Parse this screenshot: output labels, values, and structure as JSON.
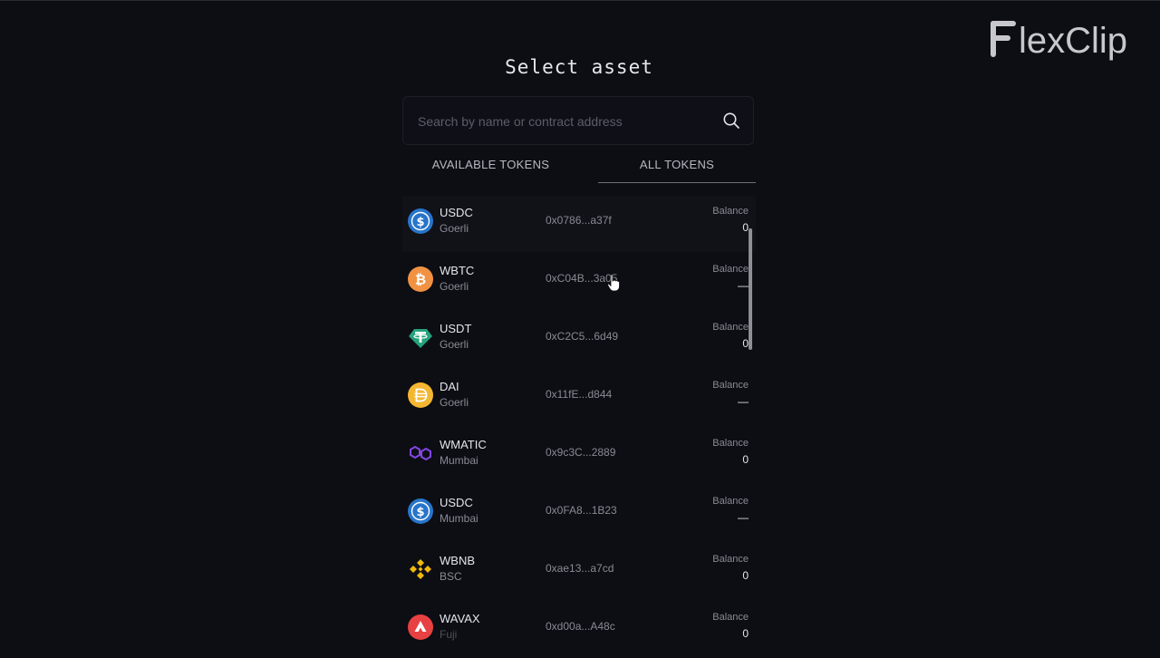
{
  "watermark": "FlexClip",
  "title": "Select asset",
  "search": {
    "placeholder": "Search by name or contract address"
  },
  "tabs": [
    {
      "label": "AVAILABLE TOKENS",
      "active": false
    },
    {
      "label": "ALL TOKENS",
      "active": true
    }
  ],
  "tokens": [
    {
      "symbol": "USDC",
      "network": "Goerli",
      "address": "0x0786...a37f",
      "balance_label": "Balance",
      "balance": "0",
      "icon": "usdc-icon"
    },
    {
      "symbol": "WBTC",
      "network": "Goerli",
      "address": "0xC04B...3a05",
      "balance_label": "Balance",
      "balance": "—",
      "icon": "wbtc-icon"
    },
    {
      "symbol": "USDT",
      "network": "Goerli",
      "address": "0xC2C5...6d49",
      "balance_label": "Balance",
      "balance": "0",
      "icon": "usdt-icon"
    },
    {
      "symbol": "DAI",
      "network": "Goerli",
      "address": "0x11fE...d844",
      "balance_label": "Balance",
      "balance": "—",
      "icon": "dai-icon"
    },
    {
      "symbol": "WMATIC",
      "network": "Mumbai",
      "address": "0x9c3C...2889",
      "balance_label": "Balance",
      "balance": "0",
      "icon": "polygon-icon"
    },
    {
      "symbol": "USDC",
      "network": "Mumbai",
      "address": "0x0FA8...1B23",
      "balance_label": "Balance",
      "balance": "—",
      "icon": "usdc-icon"
    },
    {
      "symbol": "WBNB",
      "network": "BSC",
      "address": "0xae13...a7cd",
      "balance_label": "Balance",
      "balance": "0",
      "icon": "bnb-icon"
    },
    {
      "symbol": "WAVAX",
      "network": "Fuji",
      "address": "0xd00a...A48c",
      "balance_label": "Balance",
      "balance": "0",
      "icon": "avax-icon"
    }
  ],
  "colors": {
    "background": "#0d0d14",
    "usdc": "#2775ca",
    "wbtc": "#f09242",
    "usdt": "#26a17b",
    "dai": "#f4b731",
    "polygon": "#8247e5",
    "bnb": "#f0b90b",
    "avax": "#e84142"
  }
}
